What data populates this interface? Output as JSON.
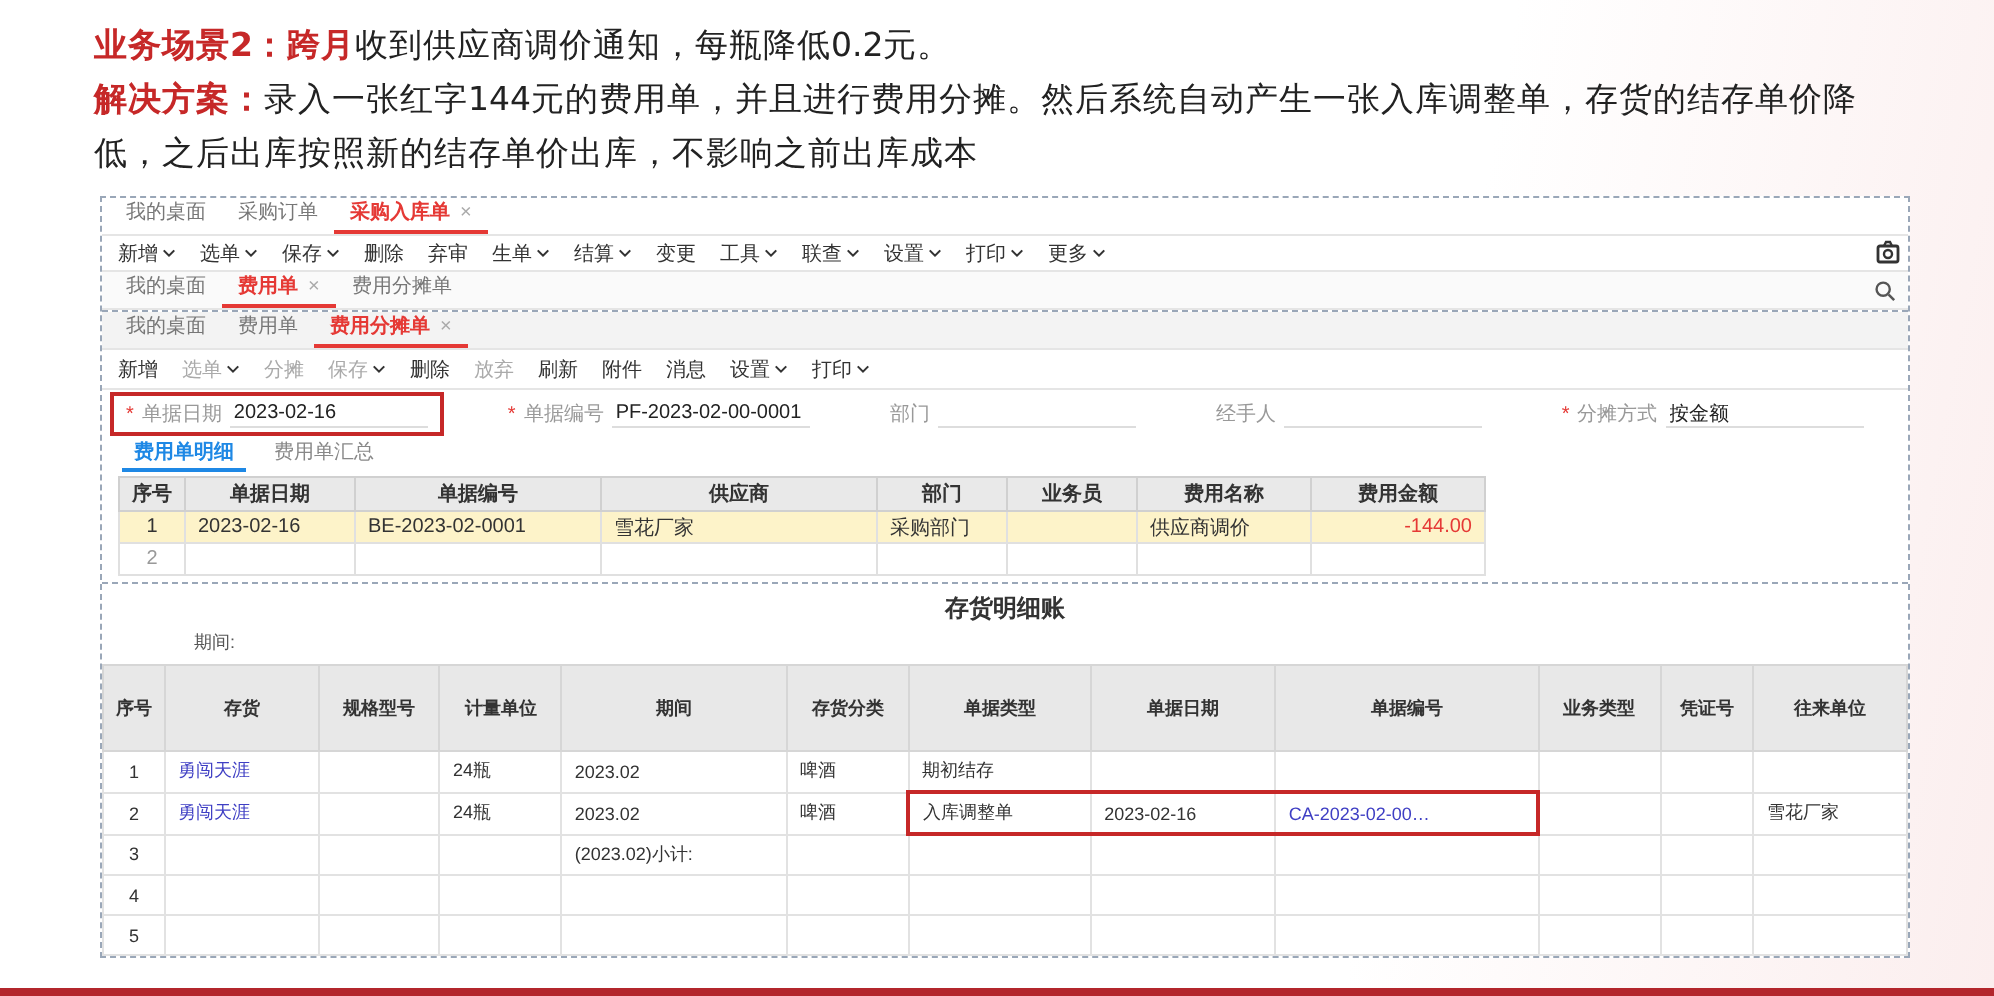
{
  "intro": {
    "scenario": "**业务场景2：跨月**收到供应商调价通知，每瓶降低0.2元。",
    "solution": "**解决方案：**录入一张红字144元的费用单，并且进行费用分摊。然后系统自动产生一张入库调整单，存货的结存单价降低，之后出库按照新的结存单价出库，不影响之前出库成本"
  },
  "back_window": {
    "tabs": [
      {
        "label": "我的桌面",
        "selected": false
      },
      {
        "label": "采购订单",
        "selected": false
      },
      {
        "label": "采购入库单",
        "selected": true,
        "close": "×"
      }
    ],
    "toolbar": [
      {
        "label": "新增",
        "dropdown": true
      },
      {
        "label": "选单",
        "dropdown": true
      },
      {
        "label": "保存",
        "dropdown": true
      },
      {
        "label": "删除",
        "dropdown": false
      },
      {
        "label": "弃审",
        "dropdown": false
      },
      {
        "label": "生单",
        "dropdown": true
      },
      {
        "label": "结算",
        "dropdown": true
      },
      {
        "label": "变更",
        "dropdown": false
      },
      {
        "label": "工具",
        "dropdown": true
      },
      {
        "label": "联查",
        "dropdown": true
      },
      {
        "label": "设置",
        "dropdown": true
      },
      {
        "label": "打印",
        "dropdown": true
      },
      {
        "label": "更多",
        "dropdown": true
      }
    ]
  },
  "middle_window": {
    "tabs": [
      {
        "label": "我的桌面",
        "selected": false
      },
      {
        "label": "费用单",
        "selected": true,
        "close": "×"
      },
      {
        "label": "费用分摊单",
        "selected": false
      }
    ]
  },
  "front_window": {
    "tabs": [
      {
        "label": "我的桌面",
        "selected": false
      },
      {
        "label": "费用单",
        "selected": false
      },
      {
        "label": "费用分摊单",
        "selected": true,
        "close": "×"
      }
    ],
    "toolbar": [
      {
        "label": "新增",
        "dropdown": false,
        "disabled": false
      },
      {
        "label": "选单",
        "dropdown": true,
        "disabled": true
      },
      {
        "label": "分摊",
        "dropdown": false,
        "disabled": true
      },
      {
        "label": "保存",
        "dropdown": true,
        "disabled": true
      },
      {
        "label": "删除",
        "dropdown": false,
        "disabled": false
      },
      {
        "label": "放弃",
        "dropdown": false,
        "disabled": true
      },
      {
        "label": "刷新",
        "dropdown": false,
        "disabled": false
      },
      {
        "label": "附件",
        "dropdown": false,
        "disabled": false
      },
      {
        "label": "消息",
        "dropdown": false,
        "disabled": false
      },
      {
        "label": "设置",
        "dropdown": true,
        "disabled": false
      },
      {
        "label": "打印",
        "dropdown": true,
        "disabled": false
      }
    ],
    "fields": [
      {
        "label": "单据日期",
        "marker": "*",
        "value": "2023-02-16",
        "highlighted": true
      },
      {
        "label": "单据编号",
        "marker": "*",
        "value": "PF-2023-02-00-0001",
        "highlighted": false
      },
      {
        "label": "部门",
        "highlighted": false
      },
      {
        "label": "经手人",
        "highlighted": false
      },
      {
        "label": "分摊方式",
        "marker": "*",
        "value": "按金额",
        "highlighted": false
      }
    ],
    "sub_tabs": [
      {
        "label": "费用单明细",
        "selected": true
      },
      {
        "label": "费用单汇总",
        "selected": false
      }
    ],
    "table": {
      "columns": [
        {
          "label": "序号",
          "kind": "index"
        },
        {
          "label": "单据日期",
          "kind": "text"
        },
        {
          "label": "单据编号",
          "kind": "text"
        },
        {
          "label": "供应商",
          "kind": "text"
        },
        {
          "label": "部门",
          "kind": "text"
        },
        {
          "label": "业务员",
          "kind": "text"
        },
        {
          "label": "费用名称",
          "kind": "text"
        },
        {
          "label": "费用金额",
          "kind": "amount"
        }
      ],
      "rows": [
        {
          "selected": true,
          "cells": [
            "1",
            "2023-02-16",
            "BE-2023-02-0001",
            "雪花厂家",
            "采购部门",
            "",
            "供应商调价",
            "-144.00"
          ]
        },
        {
          "selected": false,
          "cells": [
            "2",
            "",
            "",
            "",
            "",
            "",
            "",
            ""
          ]
        }
      ]
    }
  },
  "report": {
    "title": "存货明细账",
    "period_label": "期间:",
    "columns": [
      "序号",
      "存货",
      "规格型号",
      "计量单位",
      "期间",
      "存货分类",
      "单据类型",
      "单据日期",
      "单据编号",
      "业务类型",
      "凭证号",
      "往来单位"
    ],
    "rows": [
      {
        "cells": [
          "1",
          {
            "text": "勇闯天涯",
            "link": true
          },
          "",
          "24瓶",
          "2023.02",
          "啤酒",
          "期初结存",
          "",
          "",
          "",
          "",
          ""
        ]
      },
      {
        "cells": [
          "2",
          {
            "text": "勇闯天涯",
            "link": true
          },
          "",
          "24瓶",
          "2023.02",
          "啤酒",
          {
            "text": "入库调整单",
            "highlighted": true
          },
          {
            "text": "2023-02-16",
            "highlighted": true
          },
          {
            "text": "CA-2023-02-00…",
            "link": true,
            "highlighted": true
          },
          "",
          "",
          "雪花厂家"
        ]
      },
      {
        "cells": [
          "3",
          "",
          "",
          "",
          "(2023.02)小计:",
          "",
          "",
          "",
          "",
          "",
          "",
          ""
        ]
      },
      {
        "cells": [
          "4",
          "",
          "",
          "",
          "",
          "",
          "",
          "",
          "",
          "",
          "",
          ""
        ]
      },
      {
        "cells": [
          "5",
          "",
          "",
          "",
          "",
          "",
          "",
          "",
          "",
          "",
          "",
          ""
        ]
      }
    ]
  }
}
